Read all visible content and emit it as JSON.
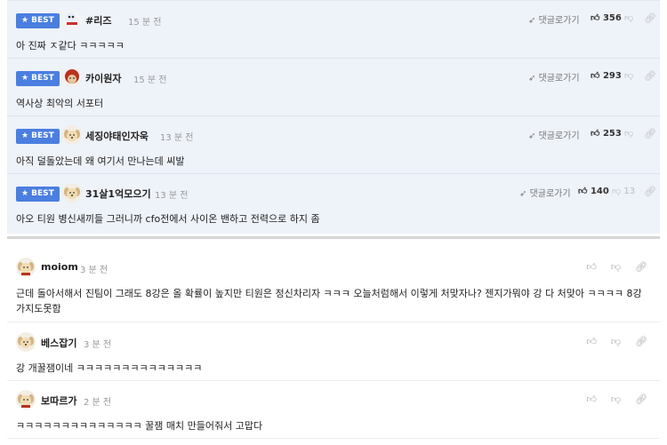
{
  "best_label": "BEST",
  "reply_label": "댓글로가기",
  "best_comments": [
    {
      "nick": "#리즈",
      "time": "15 분 전",
      "text": "아 진짜 ㅈ같다 ㅋㅋㅋㅋㅋ",
      "likes": "356",
      "dislikes": ""
    },
    {
      "nick": "카이원자",
      "time": "15 분 전",
      "text": "역사상 최악의 서포터",
      "likes": "293",
      "dislikes": ""
    },
    {
      "nick": "세징야태인자욱",
      "time": "13 분 전",
      "text": "아직 덜돌았는데 왜 여기서 만나는데 씨발",
      "likes": "253",
      "dislikes": ""
    },
    {
      "nick": "31살1억모으기",
      "time": "13 분 전",
      "text": "아오 티원 병신새끼들 그러니까 cfo전에서 사이온 밴하고 전력으로 하지 좀",
      "likes": "140",
      "dislikes": "13"
    }
  ],
  "comments": [
    {
      "nick": "moiom",
      "time": "3 분 전",
      "text": "근데 돌아서해서 진팀이 그래도 8강은 올 확률이 높지만 티원은 정신차리자 ㅋㅋㅋ 오늘처럼해서 이렇게 처맞자나? 젠지가뭐야 강 다 처맞아 ㅋㅋㅋㅋ 8강 가지도못함"
    },
    {
      "nick": "베스잡기",
      "time": "3 분 전",
      "text": "강 개꿀잼이네 ㅋㅋㅋㅋㅋㅋㅋㅋㅋㅋㅋㅋㅋㅋ"
    },
    {
      "nick": "보따르가",
      "time": "2 분 전",
      "text": "ㅋㅋㅋㅋㅋㅋㅋㅋㅋㅋㅋㅋㅋㅋ 꿀잼 매치 만들어줘서 고맙다"
    }
  ],
  "colors": {
    "best_badge": "#4a7fe0",
    "best_bg": "#eef2f9"
  },
  "icons": {
    "reply": "paper-plane-icon",
    "like": "thumbs-up-icon",
    "dislike": "thumbs-down-icon",
    "link": "link-icon"
  }
}
